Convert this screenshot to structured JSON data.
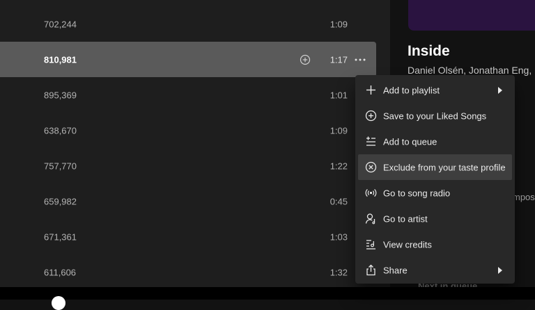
{
  "tracks": [
    {
      "plays": "702,244",
      "duration": "1:09"
    },
    {
      "plays": "810,981",
      "duration": "1:17"
    },
    {
      "plays": "895,369",
      "duration": "1:01"
    },
    {
      "plays": "638,670",
      "duration": "1:09"
    },
    {
      "plays": "757,770",
      "duration": "1:22"
    },
    {
      "plays": "659,982",
      "duration": "0:45"
    },
    {
      "plays": "671,361",
      "duration": "1:03"
    },
    {
      "plays": "611,606",
      "duration": "1:32"
    }
  ],
  "now_playing": {
    "title": "Inside",
    "artists": "Daniel Olsén, Jonathan Eng,",
    "credit_snippet": "mpos",
    "next_in_queue": "Next in queue"
  },
  "context_menu": {
    "items": [
      {
        "label": "Add to playlist",
        "icon": "plus-icon"
      },
      {
        "label": "Save to your Liked Songs",
        "icon": "add-circle-icon"
      },
      {
        "label": "Add to queue",
        "icon": "queue-icon"
      },
      {
        "label": "Exclude from your taste profile",
        "icon": "exclude-icon"
      },
      {
        "label": "Go to song radio",
        "icon": "radio-icon"
      },
      {
        "label": "Go to artist",
        "icon": "artist-icon"
      },
      {
        "label": "View credits",
        "icon": "credits-icon"
      },
      {
        "label": "Share",
        "icon": "share-icon"
      }
    ]
  },
  "colors": {
    "background": "#121212",
    "track_list": "#1e1e1e",
    "row_hover": "#5a5a5a",
    "menu": "#282828",
    "menu_highlight": "#3e3e3e",
    "album_accent": "#2a1340"
  }
}
